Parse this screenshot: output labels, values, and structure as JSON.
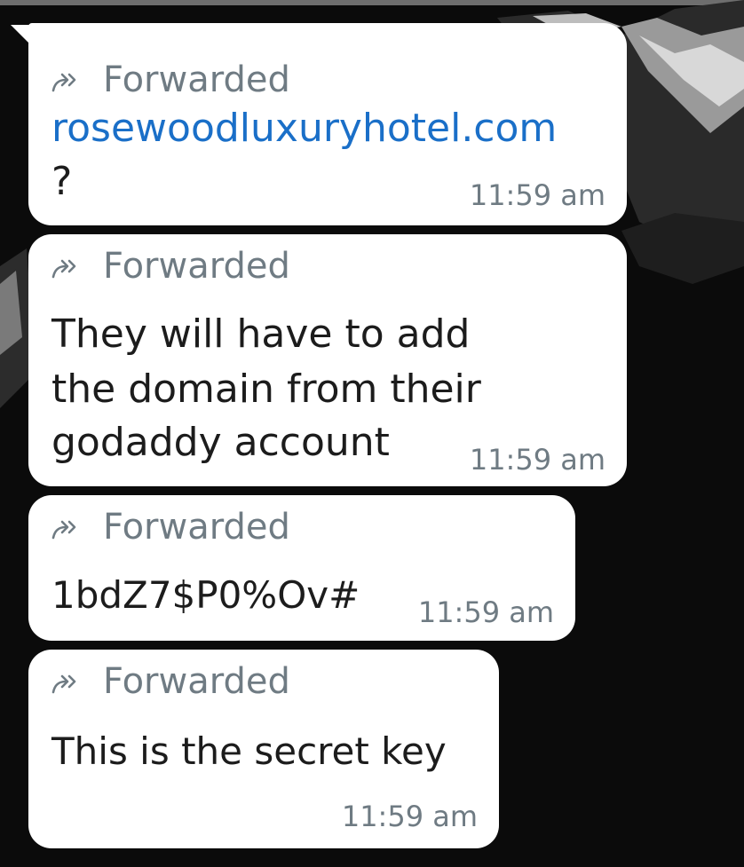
{
  "messages": [
    {
      "forwarded_label": "Forwarded",
      "text_link": "rosewoodluxuryhotel.com",
      "text_rest": "?",
      "time": "11:59 am"
    },
    {
      "forwarded_label": "Forwarded",
      "lines": [
        "They will have to add",
        "the domain from their",
        "godaddy account"
      ],
      "time": "11:59 am"
    },
    {
      "forwarded_label": "Forwarded",
      "text": "1bdZ7$P0%Ov#",
      "time": "11:59 am"
    },
    {
      "forwarded_label": "Forwarded",
      "text": "This is the secret key",
      "time": "11:59 am"
    }
  ],
  "colors": {
    "background": "#0b0b0b",
    "bubble": "#ffffff",
    "link": "#1a6fc8",
    "meta_text": "#6f7b83"
  },
  "icons": {
    "forward": "forward-icon"
  }
}
